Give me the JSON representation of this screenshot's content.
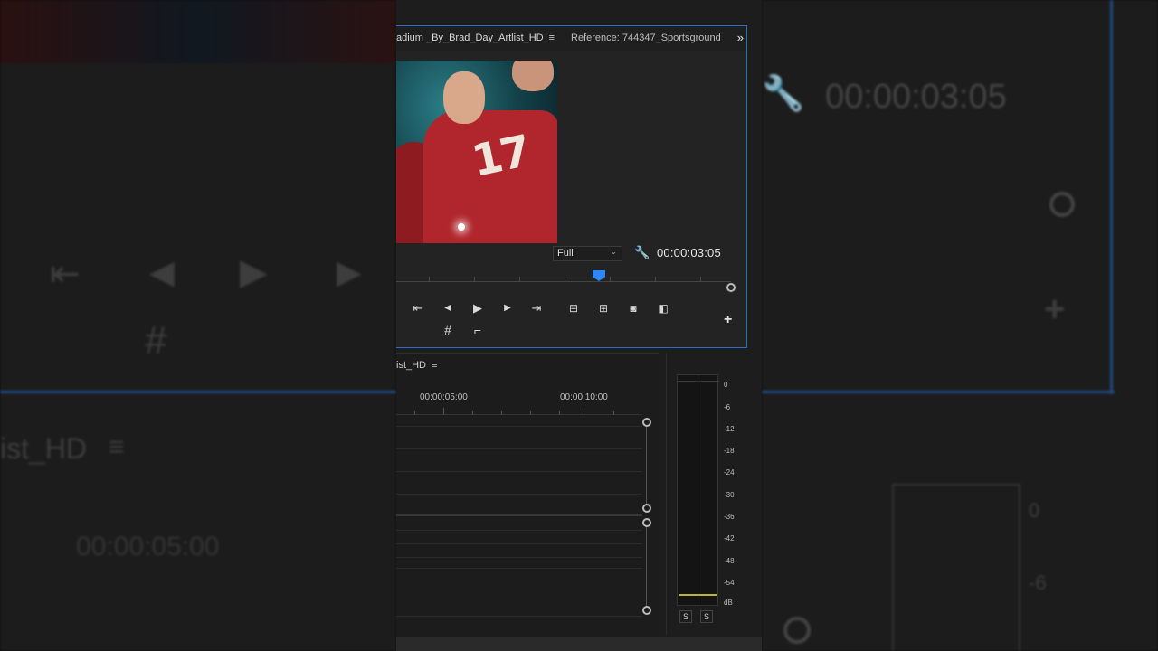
{
  "monitor": {
    "active_tab": "adium _By_Brad_Day_Artlist_HD",
    "reference_tab": "Reference: 744347_Sportsground",
    "more_icon": "»",
    "zoom_level": "Full",
    "timecode": "00:00:03:05"
  },
  "controls": {
    "go_to_in": "⇤",
    "step_back": "◀",
    "play": "▶",
    "step_forward": "▶",
    "go_to_out": "⇥",
    "add": "+",
    "marker": "#",
    "crop": "⌐"
  },
  "timeline": {
    "title": "ist_HD",
    "time_1": "00:00:05:00",
    "time_2": "00:00:10:00"
  },
  "meters": {
    "scale": [
      "0",
      "-6",
      "-12",
      "-18",
      "-24",
      "-30",
      "-36",
      "-42",
      "-48",
      "-54",
      "dB"
    ],
    "solo_left": "S",
    "solo_right": "S"
  },
  "background": {
    "left_timecode": "00:00:05:00",
    "left_title": "ist_HD",
    "right_timecode": "00:00:03:05",
    "right_scale_0": "0",
    "right_scale_6": "-6"
  }
}
